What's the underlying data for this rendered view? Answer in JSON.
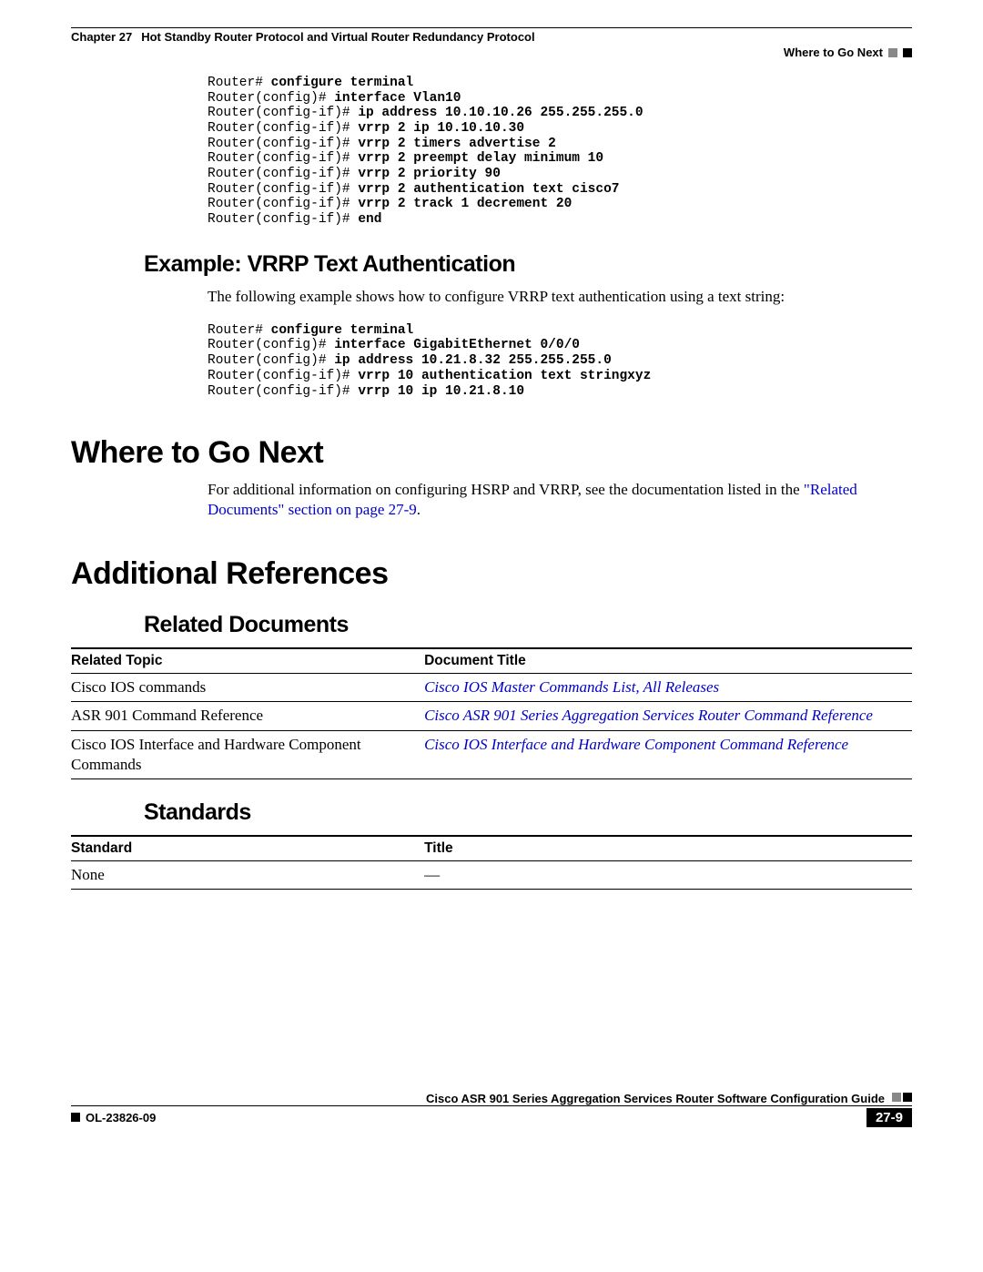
{
  "header": {
    "chapter_label": "Chapter 27",
    "chapter_title": "Hot Standby Router Protocol and Virtual Router Redundancy Protocol",
    "section": "Where to Go Next"
  },
  "code1": {
    "l1p": "Router# ",
    "l1b": "configure terminal",
    "l2p": "Router(config)# ",
    "l2b": "interface Vlan10",
    "l3p": "Router(config-if)# ",
    "l3b": "ip address 10.10.10.26 255.255.255.0",
    "l4p": "Router(config-if)# ",
    "l4b": "vrrp 2 ip 10.10.10.30",
    "l5p": "Router(config-if)# ",
    "l5b": "vrrp 2 timers advertise 2",
    "l6p": "Router(config-if)# ",
    "l6b": "vrrp 2 preempt delay minimum 10",
    "l7p": "Router(config-if)# ",
    "l7b": "vrrp 2 priority 90",
    "l8p": "Router(config-if)# ",
    "l8b": "vrrp 2 authentication text cisco7",
    "l9p": "Router(config-if)# ",
    "l9b": "vrrp 2 track 1 decrement 20",
    "l10p": "Router(config-if)# ",
    "l10b": "end"
  },
  "h_example": "Example: VRRP Text Authentication",
  "p_example": "The following example shows how to configure VRRP text authentication using a text string:",
  "code2": {
    "l1p": "Router# ",
    "l1b": "configure terminal",
    "l2p": "Router(config)# ",
    "l2b": "interface GigabitEthernet 0/0/0",
    "l3p": "Router(config)# ",
    "l3b": "ip address 10.21.8.32 255.255.255.0",
    "l4p": "Router(config-if)# ",
    "l4b": "vrrp 10 authentication text stringxyz",
    "l5p": "Router(config-if)# ",
    "l5b": "vrrp 10 ip 10.21.8.10"
  },
  "h_where": "Where to Go Next",
  "p_where_a": "For additional information on configuring HSRP and VRRP, see the documentation listed in the ",
  "p_where_link": "\"Related Documents\" section on page 27-9",
  "p_where_b": ".",
  "h_addref": "Additional References",
  "h_related": "Related Documents",
  "table1": {
    "h1": "Related Topic",
    "h2": "Document Title",
    "r1c1": "Cisco IOS commands",
    "r1c2": "Cisco IOS Master Commands List, All Releases",
    "r2c1": "ASR 901 Command Reference",
    "r2c2": "Cisco ASR 901 Series Aggregation Services Router Command Reference",
    "r3c1": "Cisco IOS Interface and Hardware Component Commands",
    "r3c2": "Cisco IOS Interface and Hardware Component Command Reference"
  },
  "h_standards": "Standards",
  "table2": {
    "h1": "Standard",
    "h2": "Title",
    "r1c1": "None",
    "r1c2": "—"
  },
  "footer": {
    "guide": "Cisco ASR 901 Series Aggregation Services Router Software Configuration Guide",
    "doc_id": "OL-23826-09",
    "page": "27-9"
  }
}
